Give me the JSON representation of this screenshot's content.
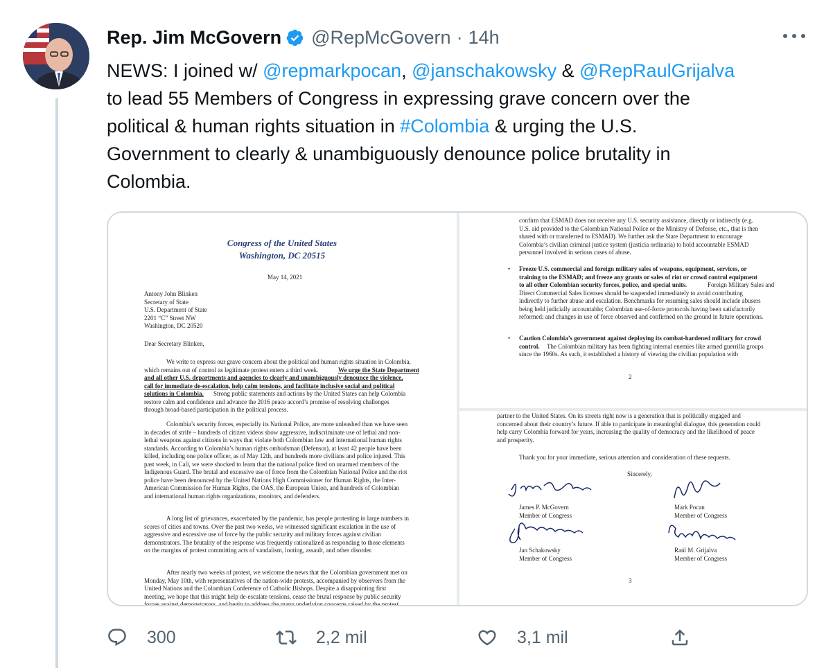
{
  "tweet": {
    "author_name": "Rep. Jim McGovern",
    "handle": "@RepMcGovern",
    "separator": "·",
    "time": "14h",
    "lines": [
      {
        "parts": [
          {
            "t": "text",
            "v": "NEWS: I joined w/ "
          },
          {
            "t": "mention",
            "v": "@repmarkpocan"
          },
          {
            "t": "text",
            "v": ", "
          },
          {
            "t": "mention",
            "v": "@janschakowsky"
          },
          {
            "t": "text",
            "v": " & "
          },
          {
            "t": "mention",
            "v": "@RepRaulGrijalva"
          }
        ]
      },
      {
        "parts": [
          {
            "t": "text",
            "v": "to lead 55 Members of Congress in expressing grave concern over the"
          }
        ]
      },
      {
        "parts": [
          {
            "t": "text",
            "v": "political & human rights situation in "
          },
          {
            "t": "hashtag",
            "v": "#Colombia"
          },
          {
            "t": "text",
            "v": " & urging the U.S."
          }
        ]
      },
      {
        "parts": [
          {
            "t": "text",
            "v": "Government to clearly & unambiguously denounce police brutality in"
          }
        ]
      },
      {
        "parts": [
          {
            "t": "text",
            "v": "Colombia."
          }
        ]
      }
    ]
  },
  "letter": {
    "letterhead_1": "Congress of the United States",
    "letterhead_2": "Washington, DC 20515",
    "date": "May 14, 2021",
    "address": [
      "Antony John Blinken",
      "Secretary of State",
      "U.S. Department of State",
      "2201 “C” Street NW",
      "Washington, DC 20520"
    ],
    "salutation": "Dear Secretary Blinken,",
    "p1": [
      "We write to express our grave concern about the political and human rights situation in Colombia,",
      "which remains out of control as legitimate protest enters a third week.",
      "We urge the State Department",
      "and all other U.S. departments and agencies to clearly and unambiguously denounce the violence,",
      "call for immediate de-escalation, help calm tensions, and facilitate inclusive social and political",
      "solutions in Colombia.",
      "Strong public statements and actions by the United States can help Colombia",
      "restore calm and confidence and advance the 2016 peace accord’s promise of resolving challenges",
      "through broad-based participation in the political process."
    ],
    "p2": [
      "Colombia’s security forces, especially its National Police, are more unleashed than we have seen",
      "in decades of strife – hundreds of citizen videos show aggressive, indiscriminate use of lethal and non-",
      "lethal weapons against citizens in ways that violate both Colombian law and international human rights",
      "standards. According to Colombia’s human rights ombudsman (Defensor), at least 42 people have been",
      "killed, including one police officer, as of May 12th, and hundreds more civilians and police injured. This",
      "past week, in Cali, we were shocked to learn that the national police fired on unarmed members of the",
      "Indigenous Guard. The brutal and excessive use of force from the Colombian National Police and the riot",
      "police have been denounced by the United Nations High Commissioner for Human Rights, the Inter-",
      "American Commission for Human Rights, the OAS, the European Union, and hundreds of Colombian",
      "and international human rights organizations, monitors, and defenders."
    ],
    "p3": [
      "A long list of grievances, exacerbated by the pandemic, has people protesting in large numbers in",
      "scores of cities and towns.  Over the past two weeks, we witnessed significant escalation in the use of",
      "aggressive and excessive use of force by the public security and military forces against civilian",
      "demonstrators. The brutality of the response was frequently rationalized as responding to those elements",
      "on the margins of protest committing acts of vandalism, looting, assault, and other disorder."
    ],
    "p4": [
      "After nearly two weeks of protest, we welcome the news that the Colombian government met on",
      "Monday, May 10th, with representatives of the nation-wide protests, accompanied by observers from the",
      "United Nations and the Colombian Conference of Catholic Bishops.  Despite a disappointing first",
      "meeting, we hope that this might help de-escalate tensions, cease the brutal response by public security",
      "forces against demonstrators, and begin to address the many underlying concerns raised by the protest."
    ],
    "page2_top": [
      "confirm that ESMAD does not receive any U.S. security assistance, directly or indirectly (e.g.",
      "U.S. aid provided to the Colombian National Police or the Ministry of Defense, etc., that is then",
      "shared with or transferred to ESMAD). We further ask the State Department to encourage",
      "Colombia’s civilian criminal justice system (justicia ordinaria) to hold accountable ESMAD",
      "personnel involved in serious cases of abuse."
    ],
    "bullet1": [
      "Freeze U.S. commercial and foreign military sales of weapons, equipment, services, or",
      "training to the ESMAD; and freeze any grants or sales of riot or crowd control equipment",
      "to all other Colombian security forces, police, and special units.",
      "Foreign Military Sales and",
      "Direct Commercial Sales licenses should be suspended immediately to avoid contributing",
      "indirectly to further abuse and escalation. Benchmarks for resuming sales should include  abusers",
      "being held judicially accountable; Colombian use-of-force protocols having been satisfactorily",
      "reformed; and changes in use of force observed and confirmed on the ground in future operations."
    ],
    "bullet2": [
      "Caution Colombia’s government against deploying its combat-hardened military for crowd",
      "control.",
      "The Colombian military has been fighting internal enemies like armed guerrilla groups",
      "since the 1960s. As such, it established a history of viewing the civilian population with"
    ],
    "page2_number": "2",
    "page3_top": [
      "partner to the United States. On its streets right now is a generation that is politically engaged and",
      "concerned about their country’s future. If able to participate in meaningful dialogue, this generation could",
      "help carry Colombia forward for years, increasing the quality of democracy and the likelihood of peace",
      "and prosperity."
    ],
    "thanks": "Thank you for your immediate, serious attention and consideration of these requests.",
    "closing": "Sincerely,",
    "signers": [
      {
        "name": "James P. McGovern",
        "role": "Member of Congress"
      },
      {
        "name": "Mark Pocan",
        "role": "Member of Congress"
      },
      {
        "name": "Jan Schakowsky",
        "role": "Member of Congress"
      },
      {
        "name": "Raúl M. Grijalva",
        "role": "Member of Congress"
      }
    ],
    "page3_number": "3"
  },
  "actions": {
    "reply_count": "300",
    "retweet_count": "2,2 mil",
    "like_count": "3,1 mil"
  },
  "icons": {
    "verified": "verified-badge-icon",
    "more": "more-options-icon",
    "reply": "reply-icon",
    "retweet": "retweet-icon",
    "like": "heart-icon",
    "share": "share-icon"
  },
  "colors": {
    "accent": "#1d9bf0",
    "text": "#0f1419",
    "secondary": "#536471",
    "letterhead": "#2b3f7a"
  }
}
